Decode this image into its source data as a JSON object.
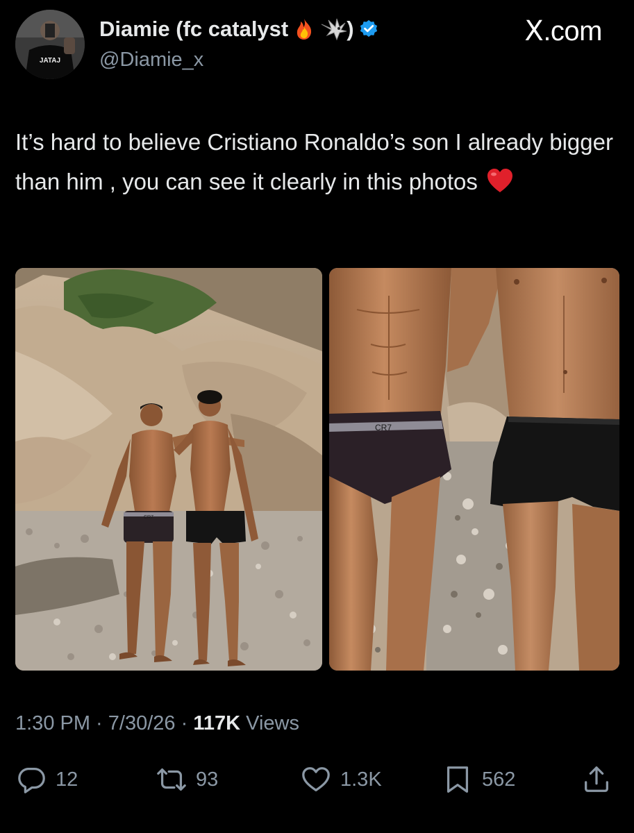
{
  "author": {
    "display_name": "Diamie (fc catalyst",
    "name_close": ")",
    "name_emojis": [
      "fire-emoji",
      "eagle-emoji"
    ],
    "verified": true,
    "handle": "@Diamie_x",
    "avatar_shirt_text": "JATAJ"
  },
  "brand": {
    "x_glyph": "X",
    "suffix": ".com"
  },
  "tweet": {
    "text": "It’s hard to believe Cristiano Ronaldo’s son I already bigger than him , you can see it clearly in this photos",
    "trailing_emoji": "red-heart-emoji"
  },
  "media": {
    "left_photo": {
      "description_icon": "photo-two-people-beach",
      "waistband_text": "CR7"
    },
    "right_photo": {
      "description_icon": "photo-closeup-torsos",
      "waistband_text": "CR7"
    }
  },
  "meta": {
    "time": "1:30 PM",
    "sep1": " · ",
    "date": "7/30/26",
    "sep2": " · ",
    "views_count": "117K",
    "views_label": " Views"
  },
  "actions": {
    "replies": "12",
    "reposts": "93",
    "likes": "1.3K",
    "bookmarks": "562"
  },
  "colors": {
    "background": "#000000",
    "text_primary": "#e7e9ea",
    "text_secondary": "#8b98a5",
    "verified_blue": "#1d9bf0"
  }
}
